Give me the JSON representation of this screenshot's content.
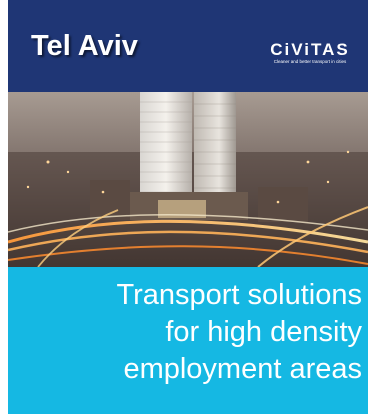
{
  "header": {
    "title": "Tel Aviv",
    "logo": {
      "wordmark": "CiViTAS",
      "tagline": "Cleaner and better transport in cities"
    }
  },
  "photo": {
    "icon": "city-night-skyline-image"
  },
  "footer": {
    "lines": [
      "Transport solutions",
      "for high density",
      "employment areas"
    ]
  },
  "colors": {
    "header_bg": "#1f3675",
    "footer_bg": "#15b8e3",
    "text": "#ffffff"
  }
}
